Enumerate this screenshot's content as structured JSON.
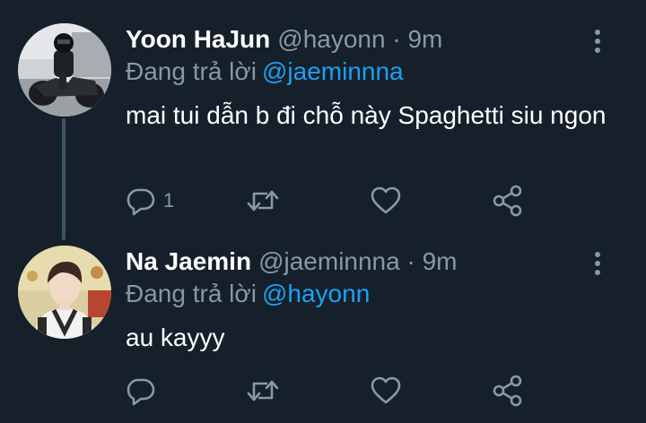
{
  "tweets": [
    {
      "display_name": "Yoon HaJun",
      "handle": "@hayonn",
      "separator": "·",
      "time": "9m",
      "reply_label": "Đang trả lời",
      "reply_handle": "@jaeminnna",
      "text": "mai tui dẫn b đi chỗ này Spaghetti siu ngon",
      "reply_count": "1",
      "avatar_icon": "avatar-photo-motorcycle",
      "icons": [
        "reply-icon",
        "retweet-icon",
        "like-icon",
        "share-icon",
        "more-icon"
      ]
    },
    {
      "display_name": "Na Jaemin",
      "handle": "@jaeminnna",
      "separator": "·",
      "time": "9m",
      "reply_label": "Đang trả lời",
      "reply_handle": "@hayonn",
      "text": "au kayyy",
      "reply_count": "",
      "avatar_icon": "avatar-photo-portrait",
      "icons": [
        "reply-icon",
        "retweet-icon",
        "like-icon",
        "share-icon",
        "more-icon"
      ]
    }
  ],
  "colors": {
    "background": "#15202b",
    "primary_text": "#ffffff",
    "secondary_text": "#8899a6",
    "link": "#1da1f2",
    "thread_line": "#3d5466"
  }
}
